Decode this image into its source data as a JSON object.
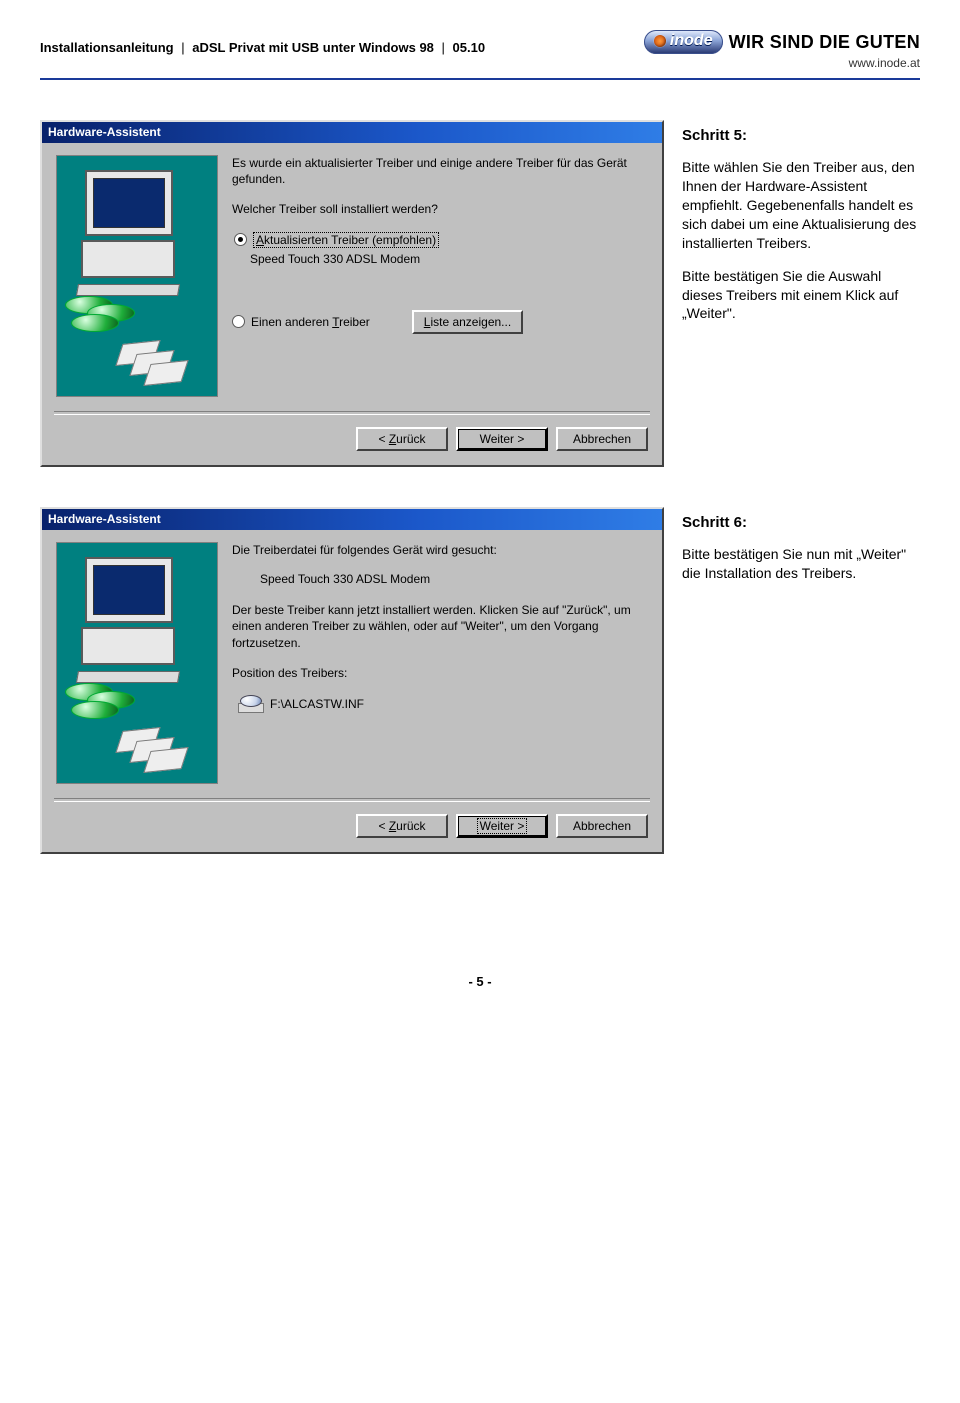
{
  "header": {
    "title": "Installationsanleitung",
    "sep": "|",
    "subtitle": "aDSL Privat mit USB unter Windows 98",
    "version": "05.10",
    "brand": "inode",
    "slogan": "WIR SIND DIE GUTEN",
    "site": "www.inode.at"
  },
  "step5": {
    "heading": "Schritt 5:",
    "p1": "Bitte wählen Sie den Treiber aus, den Ihnen der Hardware-Assistent empfiehlt. Gegebenenfalls handelt es sich dabei um eine Aktualisierung des installierten Treibers.",
    "p2": "Bitte bestätigen Sie die Auswahl dieses Treibers mit einem Klick auf „Weiter\"."
  },
  "dlg5": {
    "title": "Hardware-Assistent",
    "line1": "Es wurde ein aktualisierter Treiber und einige andere Treiber für das Gerät gefunden.",
    "question": "Welcher Treiber soll installiert werden?",
    "opt1": "Aktualisierten Treiber (empfohlen)",
    "opt1_sub": "Speed Touch 330 ADSL Modem",
    "opt2": "Einen anderen Treiber",
    "list_btn": "Liste anzeigen...",
    "btn_back": "< Zurück",
    "btn_next": "Weiter >",
    "btn_cancel": "Abbrechen"
  },
  "step6": {
    "heading": "Schritt 6:",
    "p1": "Bitte bestätigen Sie nun mit „Weiter\" die Installation des Treibers."
  },
  "dlg6": {
    "title": "Hardware-Assistent",
    "line1": "Die Treiberdatei für folgendes Gerät wird gesucht:",
    "device": "Speed Touch 330 ADSL Modem",
    "line2": "Der beste Treiber kann jetzt installiert werden. Klicken Sie auf \"Zurück\", um einen anderen Treiber zu wählen, oder auf \"Weiter\", um den Vorgang fortzusetzen.",
    "pos_label": "Position des Treibers:",
    "pos_value": "F:\\ALCASTW.INF",
    "btn_back": "< Zurück",
    "btn_next": "Weiter >",
    "btn_cancel": "Abbrechen"
  },
  "footer": {
    "page": "- 5 -"
  }
}
